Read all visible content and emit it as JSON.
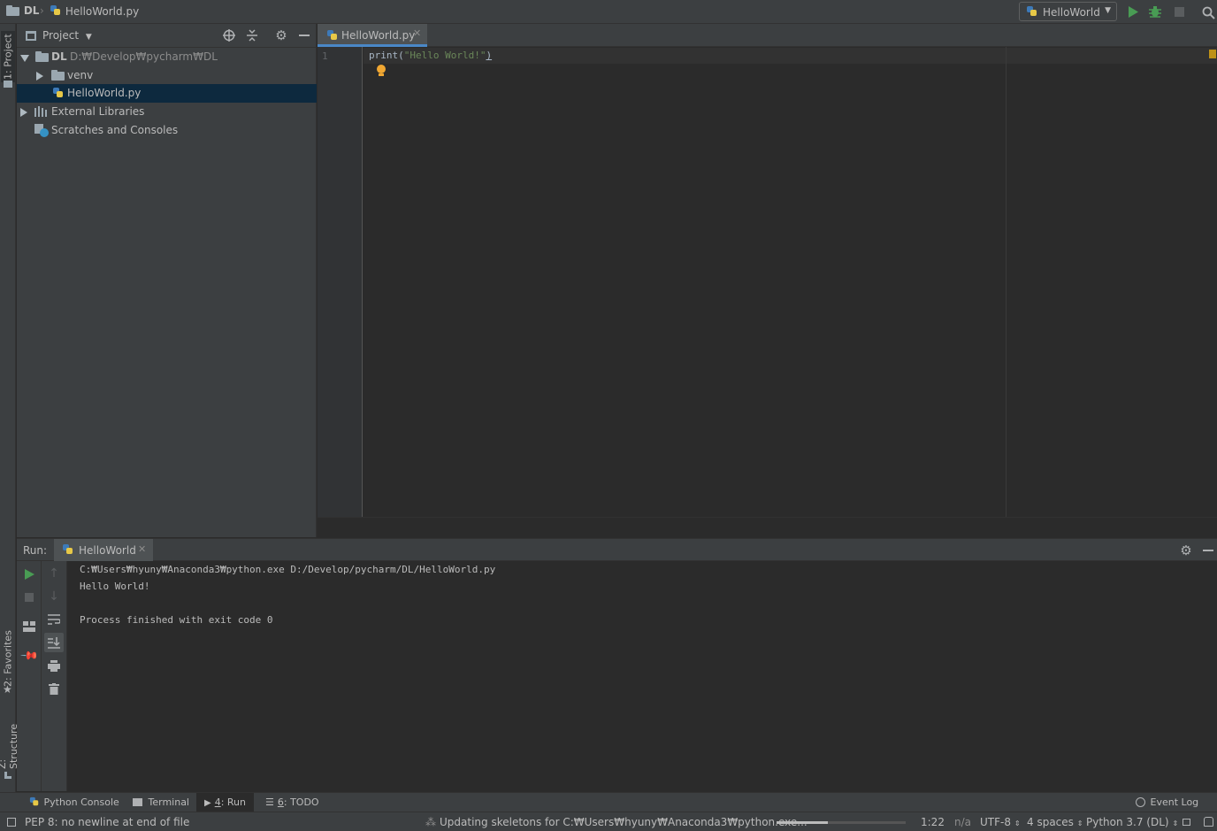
{
  "navbar": {
    "crumb_project": "DL",
    "crumb_file": "HelloWorld.py",
    "run_config": "HelloWorld"
  },
  "left_stripe": {
    "project_tab": "1: Project",
    "favorites_tab": "2: Favorites",
    "structure_tab": "Z: Structure"
  },
  "project_panel": {
    "title": "Project",
    "tree": [
      {
        "label": "DL",
        "path": "D:₩Develop₩pycharm₩DL"
      },
      {
        "label": "venv"
      },
      {
        "label": "HelloWorld.py"
      },
      {
        "label": "External Libraries"
      },
      {
        "label": "Scratches and Consoles"
      }
    ]
  },
  "editor": {
    "tab_label": "HelloWorld.py",
    "line_number": "1",
    "code_func": "print(",
    "code_string": "\"Hello World!\"",
    "code_close": ")"
  },
  "run": {
    "label": "Run:",
    "tab_label": "HelloWorld",
    "console": [
      "C:₩Users₩hyuny₩Anaconda3₩python.exe D:/Develop/pycharm/DL/HelloWorld.py",
      "Hello World!",
      "",
      "Process finished with exit code 0"
    ]
  },
  "bottom_tabs": {
    "python_console": "Python Console",
    "terminal": "Terminal",
    "run_num": "4",
    "run_label": ": Run",
    "todo_num": "6",
    "todo_label": ": TODO",
    "event_log": "Event Log"
  },
  "status": {
    "message": "PEP 8: no newline at end of file",
    "task": "Updating skeletons for C:₩Users₩hyuny₩Anaconda3₩python.exe...",
    "progress": 0.4,
    "position": "1:22",
    "na": "n/a",
    "encoding": "UTF-8",
    "indent": "4 spaces",
    "interpreter": "Python 3.7 (DL)"
  },
  "colors": {
    "accent": "#4a88c7",
    "run_green": "#499c54",
    "selection": "#0d293e",
    "string": "#6a8759"
  }
}
